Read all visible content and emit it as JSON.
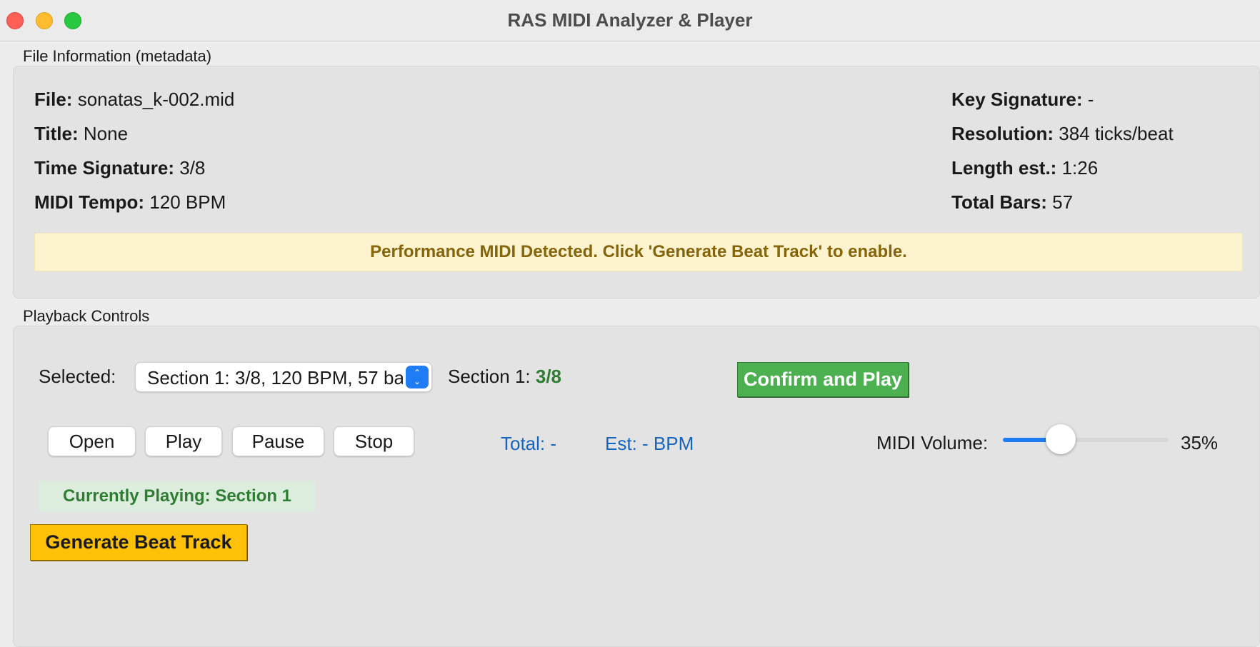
{
  "window": {
    "title": "RAS MIDI Analyzer & Player"
  },
  "file_info": {
    "group_label": "File Information (metadata)",
    "left": [
      {
        "label": "File:",
        "value": "sonatas_k-002.mid"
      },
      {
        "label": "Title:",
        "value": "None"
      },
      {
        "label": "Time Signature:",
        "value": "3/8"
      },
      {
        "label": "MIDI Tempo:",
        "value": "120 BPM"
      }
    ],
    "right": [
      {
        "label": "Key Signature:",
        "value": "-"
      },
      {
        "label": "Resolution:",
        "value": "384 ticks/beat"
      },
      {
        "label": "Length est.:",
        "value": "1:26"
      },
      {
        "label": "Total Bars:",
        "value": "57"
      }
    ],
    "banner": "Performance MIDI Detected. Click 'Generate Beat Track' to enable."
  },
  "playback": {
    "group_label": "Playback Controls",
    "selected_label": "Selected:",
    "selected_value": "Section 1: 3/8, 120 BPM, 57 ba",
    "section_label": "Section 1:",
    "section_value": "3/8",
    "confirm_button": "Confirm and Play",
    "buttons": {
      "open": "Open",
      "play": "Play",
      "pause": "Pause",
      "stop": "Stop"
    },
    "total_text": "Total: -",
    "est_text": "Est: - BPM",
    "volume_label": "MIDI Volume:",
    "volume_percent": 35,
    "volume_text": "35%",
    "currently_playing": "Currently Playing: Section 1",
    "generate_button": "Generate Beat Track"
  }
}
